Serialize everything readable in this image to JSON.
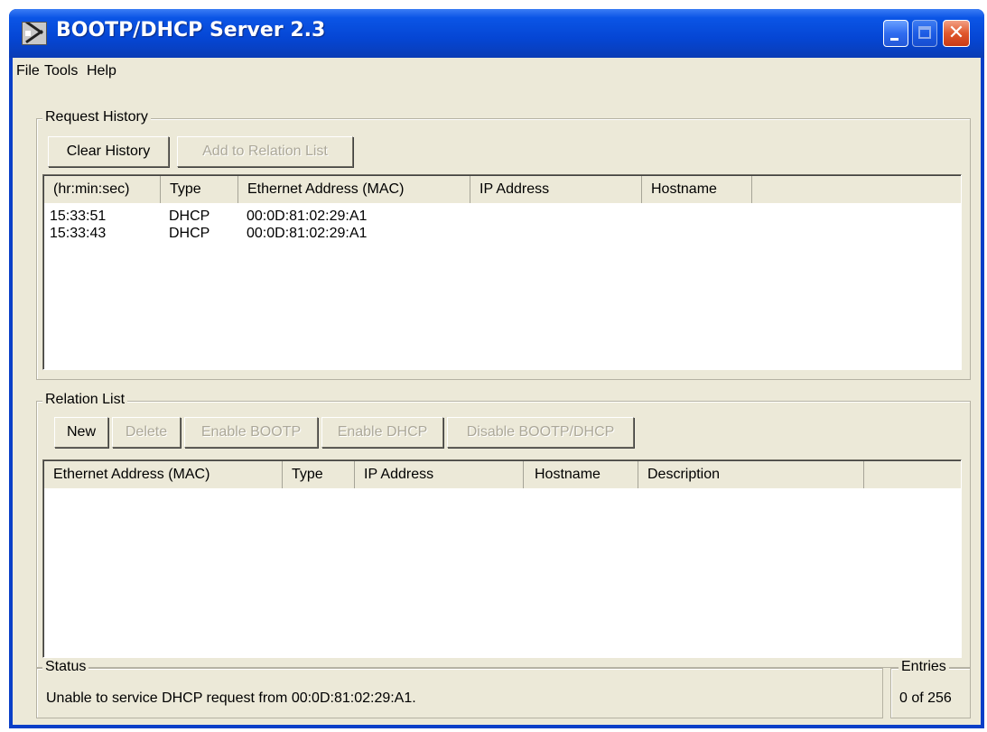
{
  "window": {
    "title": "BOOTP/DHCP Server 2.3"
  },
  "menu": [
    "File",
    "Tools",
    "Help"
  ],
  "request_history": {
    "legend": "Request History",
    "clear_button": "Clear History",
    "add_button": "Add to Relation List",
    "columns": [
      "(hr:min:sec)",
      "Type",
      "Ethernet Address (MAC)",
      "IP Address",
      "Hostname"
    ],
    "rows": [
      {
        "time": "15:33:51",
        "type": "DHCP",
        "mac": "00:0D:81:02:29:A1",
        "ip": "",
        "hostname": ""
      },
      {
        "time": "15:33:43",
        "type": "DHCP",
        "mac": "00:0D:81:02:29:A1",
        "ip": "",
        "hostname": ""
      }
    ]
  },
  "relation_list": {
    "legend": "Relation List",
    "buttons": {
      "new": "New",
      "delete": "Delete",
      "enable_bootp": "Enable BOOTP",
      "enable_dhcp": "Enable DHCP",
      "disable": "Disable BOOTP/DHCP"
    },
    "columns": [
      "Ethernet Address (MAC)",
      "Type",
      "IP Address",
      "Hostname",
      "Description"
    ]
  },
  "status": {
    "legend": "Status",
    "message": "Unable to service DHCP request from 00:0D:81:02:29:A1."
  },
  "entries": {
    "legend": "Entries",
    "value": "0 of 256"
  }
}
